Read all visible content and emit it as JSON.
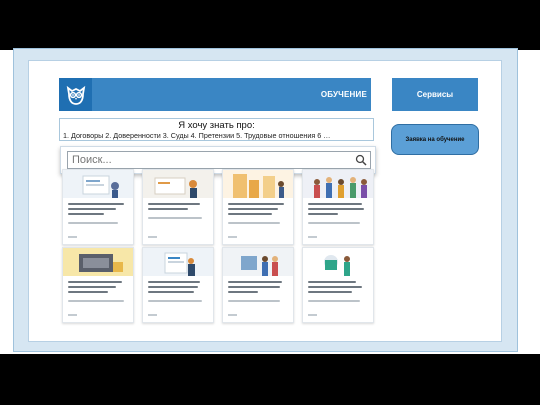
{
  "header": {
    "title": "ОБУЧЕНИЕ",
    "logo_icon": "owl-logo-icon"
  },
  "sidebar": {
    "services_label": "Сервисы",
    "request_button_label": "Заявка на обучение"
  },
  "topics": {
    "title": "Я хочу знать про:",
    "list": "1. Договоры 2. Доверенности 3. Суды 4. Претензии 5. Трудовые отношения 6 …"
  },
  "search": {
    "placeholder": "Поиск..."
  },
  "colors": {
    "accent": "#3a86c4",
    "accent_dark": "#1f6fb2",
    "button": "#5b9fd6",
    "frame": "#d6e6f2"
  }
}
